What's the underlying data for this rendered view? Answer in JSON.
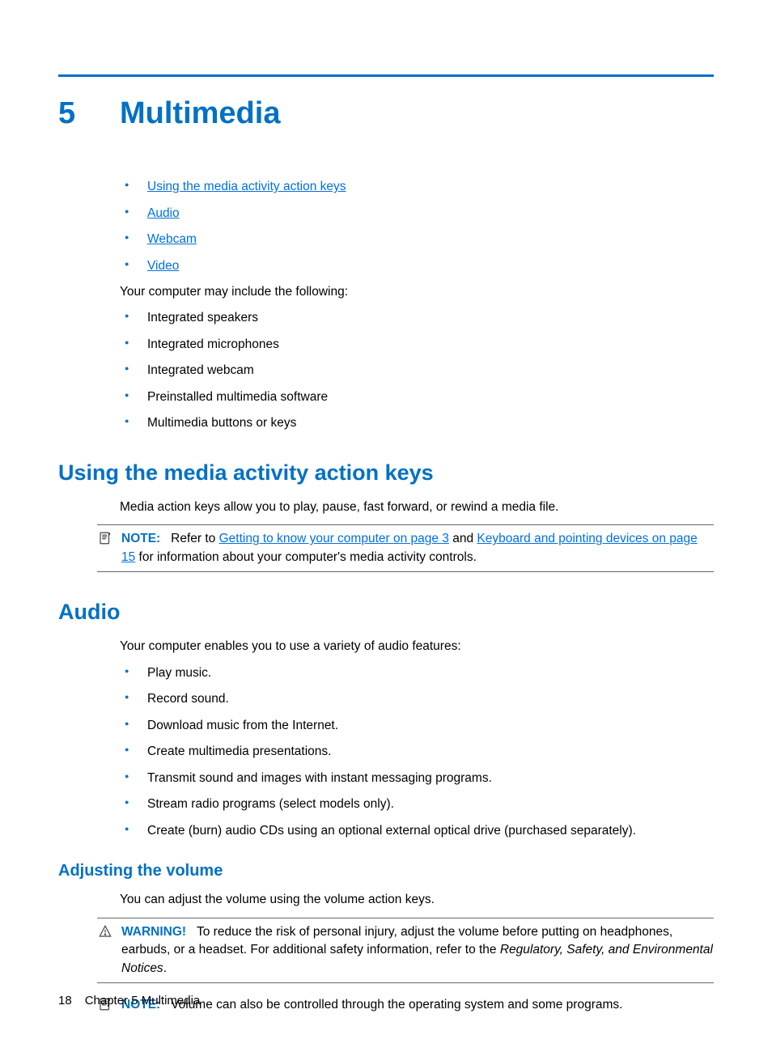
{
  "chapter": {
    "number": "5",
    "title": "Multimedia"
  },
  "toc_links": [
    "Using the media activity action keys",
    "Audio",
    "Webcam",
    "Video"
  ],
  "intro_text": "Your computer may include the following:",
  "intro_bullets": [
    "Integrated speakers",
    "Integrated microphones",
    "Integrated webcam",
    "Preinstalled multimedia software",
    "Multimedia buttons or keys"
  ],
  "sections": {
    "media_keys": {
      "heading": "Using the media activity action keys",
      "paragraph": "Media action keys allow you to play, pause, fast forward, or rewind a media file.",
      "note": {
        "label": "NOTE:",
        "before_link1": "Refer to ",
        "link1": "Getting to know your computer on page 3",
        "between": " and ",
        "link2": "Keyboard and pointing devices on page 15",
        "after": " for information about your computer's media activity controls."
      }
    },
    "audio": {
      "heading": "Audio",
      "intro": "Your computer enables you to use a variety of audio features:",
      "bullets": [
        "Play music.",
        "Record sound.",
        "Download music from the Internet.",
        "Create multimedia presentations.",
        "Transmit sound and images with instant messaging programs.",
        "Stream radio programs (select models only).",
        "Create (burn) audio CDs using an optional external optical drive (purchased separately)."
      ],
      "subsection": {
        "heading": "Adjusting the volume",
        "paragraph": "You can adjust the volume using the volume action keys.",
        "warning": {
          "label": "WARNING!",
          "text_before_italic": "To reduce the risk of personal injury, adjust the volume before putting on headphones, earbuds, or a headset. For additional safety information, refer to the ",
          "italic": "Regulatory, Safety, and Environmental Notices",
          "after": "."
        },
        "note": {
          "label": "NOTE:",
          "text": "Volume can also be controlled through the operating system and some programs."
        }
      }
    }
  },
  "footer": {
    "page_number": "18",
    "chapter_ref": "Chapter 5   Multimedia"
  }
}
